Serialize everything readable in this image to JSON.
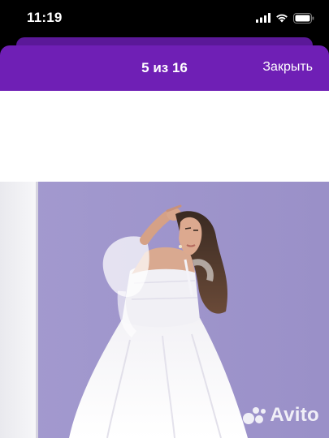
{
  "status_bar": {
    "time": "11:19",
    "icons": [
      "cellular-signal-icon",
      "wifi-icon",
      "battery-icon"
    ]
  },
  "viewer": {
    "counter": "5 из 16",
    "close_label": "Закрыть"
  },
  "photo": {
    "description_icon": "wedding-dress-photo",
    "watermark": "Avito"
  },
  "colors": {
    "nav_background": "#6f1fb5",
    "sheet_back": "#5b1899",
    "photo_wall": "#9f96cc"
  }
}
